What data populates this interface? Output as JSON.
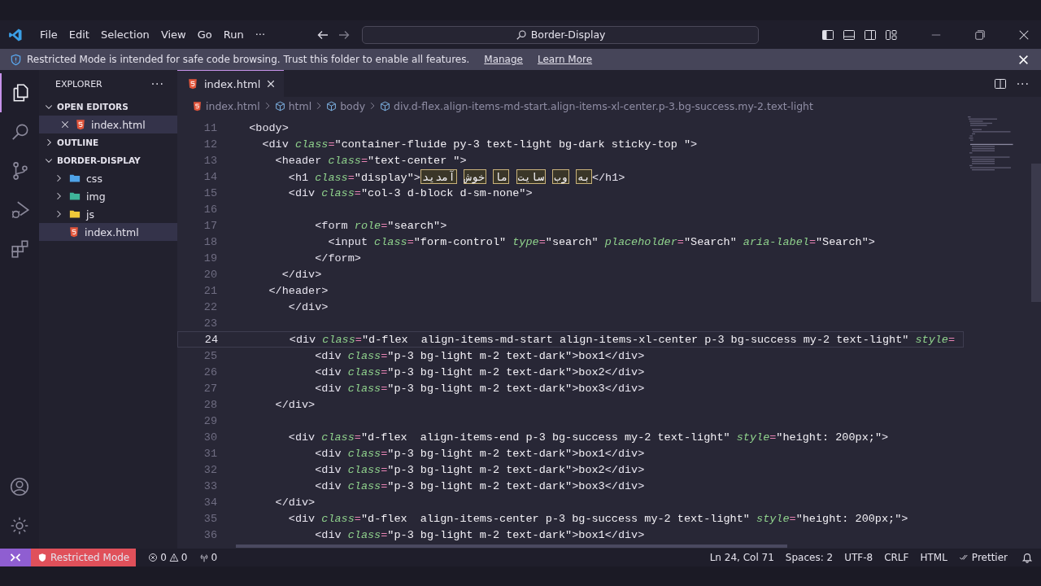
{
  "title_bar": {
    "menus": [
      "File",
      "Edit",
      "Selection",
      "View",
      "Go",
      "Run",
      "···"
    ],
    "command_center": "Border-Display"
  },
  "banner": {
    "message": "Restricted Mode is intended for safe code browsing. Trust this folder to enable all features.",
    "links": [
      "Manage",
      "Learn More"
    ]
  },
  "activity_bar": [
    {
      "kind": "files",
      "selected": true
    },
    {
      "kind": "search",
      "selected": false
    },
    {
      "kind": "source-control",
      "selected": false
    },
    {
      "kind": "run-debug",
      "selected": false
    },
    {
      "kind": "extensions",
      "selected": false
    }
  ],
  "sidebar": {
    "title": "EXPLORER",
    "more": "···",
    "sections": [
      {
        "title": "OPEN EDITORS",
        "expanded": true,
        "items": [
          {
            "label": "index.html",
            "kind": "html",
            "selected": true
          }
        ]
      },
      {
        "title": "OUTLINE",
        "expanded": false
      },
      {
        "title": "BORDER-DISPLAY",
        "expanded": true,
        "items": [
          {
            "label": "css",
            "kind": "folder-css",
            "selected": false,
            "expanded": false
          },
          {
            "label": "img",
            "kind": "folder-img",
            "selected": false,
            "expanded": false
          },
          {
            "label": "js",
            "kind": "folder-js",
            "selected": false,
            "expanded": false
          },
          {
            "label": "index.html",
            "kind": "html",
            "selected": true
          }
        ]
      }
    ]
  },
  "tabs": [
    {
      "label": "index.html",
      "selected": true
    }
  ],
  "breadcrumbs": [
    "index.html",
    "html",
    "body",
    "div.d-flex.align-items-md-start.align-items-xl-center.p-3.bg-success.my-2.text-light"
  ],
  "code": [
    {
      "n": "11",
      "current": false,
      "parts": [
        {
          "kind": "tag",
          "text": "<body>"
        }
      ]
    },
    {
      "n": "12",
      "current": false,
      "parts": [
        {
          "kind": "tag",
          "text": "<div"
        },
        {
          "kind": "attr",
          "text": "class"
        },
        {
          "kind": "eq",
          "text": "="
        },
        {
          "kind": "str",
          "text": "\"container-fluide py-3 text-light bg-dark sticky-top \""
        },
        {
          "kind": "tag",
          "text": ">"
        }
      ]
    },
    {
      "n": "13",
      "current": false,
      "parts": [
        {
          "kind": "tag",
          "text": "<header"
        },
        {
          "kind": "attr",
          "text": "class"
        },
        {
          "kind": "eq",
          "text": "="
        },
        {
          "kind": "str",
          "text": "\"text-center \""
        },
        {
          "kind": "tag",
          "text": ">"
        }
      ]
    },
    {
      "n": "14",
      "current": false,
      "parts": [
        {
          "kind": "tag",
          "text": "<h1"
        },
        {
          "kind": "attr",
          "text": "class"
        },
        {
          "kind": "eq",
          "text": "="
        },
        {
          "kind": "str",
          "text": "\"display\""
        },
        {
          "kind": "tag",
          "text": ">"
        },
        {
          "kind": "rtl",
          "text": "به وب سایت ما خوش آمدید"
        },
        {
          "kind": "tag",
          "text": "</h1>"
        }
      ]
    },
    {
      "n": "15",
      "current": false,
      "parts": [
        {
          "kind": "tag",
          "text": "<div"
        },
        {
          "kind": "attr",
          "text": "class"
        },
        {
          "kind": "eq",
          "text": "="
        },
        {
          "kind": "str",
          "text": "\"col-3 d-block d-sm-none\""
        },
        {
          "kind": "tag",
          "text": ">"
        }
      ]
    },
    {
      "n": "16",
      "current": false
    },
    {
      "n": "17",
      "current": false,
      "parts": [
        {
          "kind": "tag",
          "text": "<form"
        },
        {
          "kind": "attr",
          "text": "role"
        },
        {
          "kind": "eq",
          "text": "="
        },
        {
          "kind": "str",
          "text": "\"search\""
        },
        {
          "kind": "tag",
          "text": ">"
        }
      ]
    },
    {
      "n": "18",
      "current": false,
      "parts": [
        {
          "kind": "tag",
          "text": "<input"
        },
        {
          "kind": "attr",
          "text": "class"
        },
        {
          "kind": "eq",
          "text": "="
        },
        {
          "kind": "str",
          "text": "\"form-control\""
        },
        {
          "kind": "attr",
          "text": "type"
        },
        {
          "kind": "eq",
          "text": "="
        },
        {
          "kind": "str",
          "text": "\"search\""
        },
        {
          "kind": "attr",
          "text": "placeholder"
        },
        {
          "kind": "eq",
          "text": "="
        },
        {
          "kind": "str",
          "text": "\"Search\""
        },
        {
          "kind": "attr",
          "text": "aria-label"
        },
        {
          "kind": "eq",
          "text": "="
        },
        {
          "kind": "str",
          "text": "\"Search\""
        },
        {
          "kind": "tag",
          "text": ">"
        }
      ]
    },
    {
      "n": "19",
      "current": false,
      "parts": [
        {
          "kind": "tag",
          "text": "</form>"
        }
      ]
    },
    {
      "n": "20",
      "current": false,
      "parts": [
        {
          "kind": "tag",
          "text": "</div>"
        }
      ]
    },
    {
      "n": "21",
      "current": false,
      "parts": [
        {
          "kind": "tag",
          "text": "</header>"
        }
      ]
    },
    {
      "n": "22",
      "current": false,
      "parts": [
        {
          "kind": "tag",
          "text": "</div>"
        }
      ]
    },
    {
      "n": "23",
      "current": false
    },
    {
      "n": "24",
      "current": true,
      "parts": [
        {
          "kind": "tag",
          "text": "<div"
        },
        {
          "kind": "attr",
          "text": "class"
        },
        {
          "kind": "eq",
          "text": "="
        },
        {
          "kind": "str",
          "text": "\"d-flex  align-items-md-start align-items-xl-center p-3 bg-success my-2 text-light\""
        },
        {
          "kind": "attr",
          "text": "style"
        },
        {
          "kind": "eq",
          "text": "="
        }
      ]
    },
    {
      "n": "25",
      "current": false,
      "parts": [
        {
          "kind": "tag",
          "text": "<div"
        },
        {
          "kind": "attr",
          "text": "class"
        },
        {
          "kind": "eq",
          "text": "="
        },
        {
          "kind": "str",
          "text": "\"p-3 bg-light m-2 text-dark\""
        },
        {
          "kind": "tag",
          "text": ">"
        },
        {
          "kind": "text",
          "text": "box1"
        },
        {
          "kind": "tag",
          "text": "</div>"
        }
      ]
    },
    {
      "n": "26",
      "current": false,
      "parts": [
        {
          "kind": "tag",
          "text": "<div"
        },
        {
          "kind": "attr",
          "text": "class"
        },
        {
          "kind": "eq",
          "text": "="
        },
        {
          "kind": "str",
          "text": "\"p-3 bg-light m-2 text-dark\""
        },
        {
          "kind": "tag",
          "text": ">"
        },
        {
          "kind": "text",
          "text": "box2"
        },
        {
          "kind": "tag",
          "text": "</div>"
        }
      ]
    },
    {
      "n": "27",
      "current": false,
      "parts": [
        {
          "kind": "tag",
          "text": "<div"
        },
        {
          "kind": "attr",
          "text": "class"
        },
        {
          "kind": "eq",
          "text": "="
        },
        {
          "kind": "str",
          "text": "\"p-3 bg-light m-2 text-dark\""
        },
        {
          "kind": "tag",
          "text": ">"
        },
        {
          "kind": "text",
          "text": "box3"
        },
        {
          "kind": "tag",
          "text": "</div>"
        }
      ]
    },
    {
      "n": "28",
      "current": false,
      "parts": [
        {
          "kind": "tag",
          "text": "</div>"
        }
      ]
    },
    {
      "n": "29",
      "current": false
    },
    {
      "n": "30",
      "current": false,
      "parts": [
        {
          "kind": "tag",
          "text": "<div"
        },
        {
          "kind": "attr",
          "text": "class"
        },
        {
          "kind": "eq",
          "text": "="
        },
        {
          "kind": "str",
          "text": "\"d-flex  align-items-end p-3 bg-success my-2 text-light\""
        },
        {
          "kind": "attr",
          "text": "style"
        },
        {
          "kind": "eq",
          "text": "="
        },
        {
          "kind": "str",
          "text": "\"height: 200px;\""
        },
        {
          "kind": "tag",
          "text": ">"
        }
      ]
    },
    {
      "n": "31",
      "current": false,
      "parts": [
        {
          "kind": "tag",
          "text": "<div"
        },
        {
          "kind": "attr",
          "text": "class"
        },
        {
          "kind": "eq",
          "text": "="
        },
        {
          "kind": "str",
          "text": "\"p-3 bg-light m-2 text-dark\""
        },
        {
          "kind": "tag",
          "text": ">"
        },
        {
          "kind": "text",
          "text": "box1"
        },
        {
          "kind": "tag",
          "text": "</div>"
        }
      ]
    },
    {
      "n": "32",
      "current": false,
      "parts": [
        {
          "kind": "tag",
          "text": "<div"
        },
        {
          "kind": "attr",
          "text": "class"
        },
        {
          "kind": "eq",
          "text": "="
        },
        {
          "kind": "str",
          "text": "\"p-3 bg-light m-2 text-dark\""
        },
        {
          "kind": "tag",
          "text": ">"
        },
        {
          "kind": "text",
          "text": "box2"
        },
        {
          "kind": "tag",
          "text": "</div>"
        }
      ]
    },
    {
      "n": "33",
      "current": false,
      "parts": [
        {
          "kind": "tag",
          "text": "<div"
        },
        {
          "kind": "attr",
          "text": "class"
        },
        {
          "kind": "eq",
          "text": "="
        },
        {
          "kind": "str",
          "text": "\"p-3 bg-light m-2 text-dark\""
        },
        {
          "kind": "tag",
          "text": ">"
        },
        {
          "kind": "text",
          "text": "box3"
        },
        {
          "kind": "tag",
          "text": "</div>"
        }
      ]
    },
    {
      "n": "34",
      "current": false,
      "parts": [
        {
          "kind": "tag",
          "text": "</div>"
        }
      ]
    },
    {
      "n": "35",
      "current": false,
      "parts": [
        {
          "kind": "tag",
          "text": "<div"
        },
        {
          "kind": "attr",
          "text": "class"
        },
        {
          "kind": "eq",
          "text": "="
        },
        {
          "kind": "str",
          "text": "\"d-flex  align-items-center p-3 bg-success my-2 text-light\""
        },
        {
          "kind": "attr",
          "text": "style"
        },
        {
          "kind": "eq",
          "text": "="
        },
        {
          "kind": "str",
          "text": "\"height: 200px;\""
        },
        {
          "kind": "tag",
          "text": ">"
        }
      ]
    },
    {
      "n": "36",
      "current": false,
      "parts": [
        {
          "kind": "tag",
          "text": "<div"
        },
        {
          "kind": "attr",
          "text": "class"
        },
        {
          "kind": "eq",
          "text": "="
        },
        {
          "kind": "str",
          "text": "\"p-3 bg-light m-2 text-dark\""
        },
        {
          "kind": "tag",
          "text": ">"
        },
        {
          "kind": "text",
          "text": "box1"
        },
        {
          "kind": "tag",
          "text": "</div>"
        }
      ]
    }
  ],
  "status_bar": {
    "restricted": "Restricted Mode",
    "errors": "0",
    "warnings": "0",
    "ports": "0",
    "right": [
      "Ln 24, Col 71",
      "Spaces: 2",
      "UTF-8",
      "CRLF",
      "HTML"
    ],
    "formatter": "Prettier"
  }
}
